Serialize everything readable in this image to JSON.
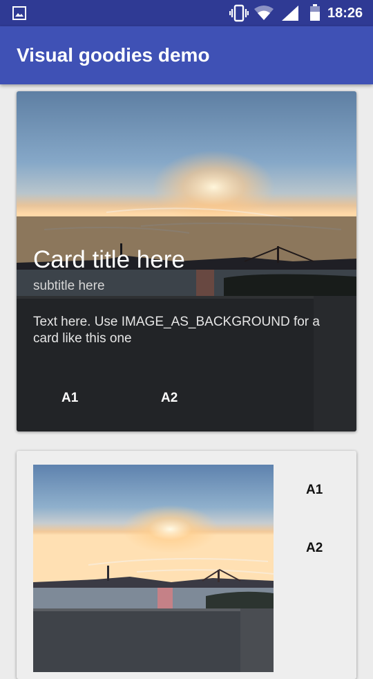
{
  "status_bar": {
    "time": "18:26",
    "icons": [
      "image-notification-icon",
      "vibrate-icon",
      "wifi-icon",
      "cell-signal-icon",
      "battery-icon"
    ]
  },
  "app_bar": {
    "title": "Visual goodies demo"
  },
  "card_background": {
    "title": "Card title here",
    "subtitle": "subtitle here",
    "text": "Text here. Use IMAGE_AS_BACKGROUND for a card like this one",
    "actions": [
      "A1",
      "A2"
    ]
  },
  "card_side_image": {
    "actions": [
      "A1",
      "A2"
    ]
  },
  "colors": {
    "status_bar": "#2f3a94",
    "app_bar": "#3f51b5",
    "background": "#ececec"
  }
}
